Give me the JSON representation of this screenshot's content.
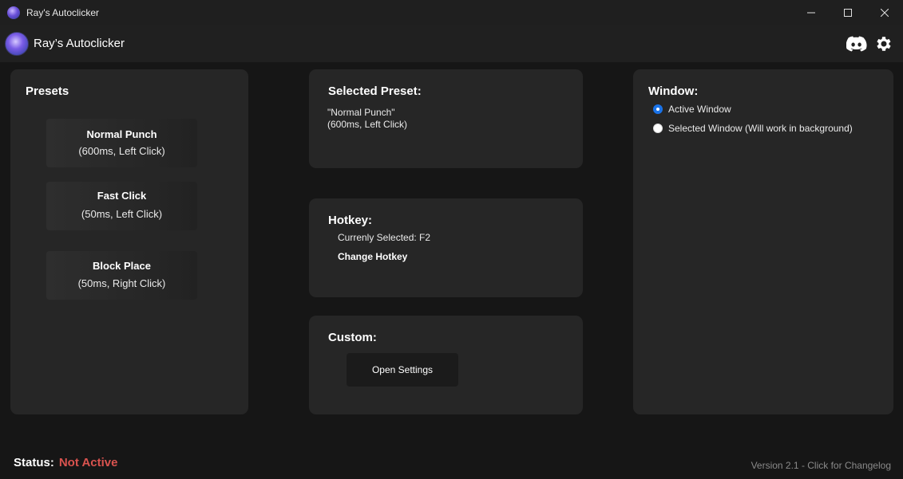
{
  "window": {
    "title": "Ray's Autoclicker",
    "controls": {
      "minimize": "minimize",
      "maximize": "maximize",
      "close": "close"
    }
  },
  "appbar": {
    "title": "Ray’s Autoclicker",
    "icons": [
      "discord-icon",
      "gear-icon"
    ]
  },
  "presets": {
    "title": "Presets",
    "items": [
      {
        "name": "Normal Punch",
        "desc": "(600ms, Left Click)"
      },
      {
        "name": "Fast Click",
        "desc": "(50ms, Left Click)"
      },
      {
        "name": "Block Place",
        "desc": "(50ms, Right Click)"
      }
    ]
  },
  "selected": {
    "title": "Selected Preset:",
    "line1": "\"Normal Punch\"",
    "line2": "(600ms, Left Click)"
  },
  "hotkey": {
    "title": "Hotkey:",
    "current": "Currenly Selected: F2",
    "change_label": "Change Hotkey"
  },
  "custom": {
    "title": "Custom:",
    "open_settings_label": "Open Settings"
  },
  "window_target": {
    "title": "Window:",
    "options": [
      {
        "label": "Active Window",
        "selected": true
      },
      {
        "label": "Selected Window (Will work in background)",
        "selected": false
      }
    ]
  },
  "status": {
    "label": "Status:",
    "value": "Not Active",
    "color": "#d9534f"
  },
  "version": "Version 2.1 - Click for Changelog",
  "colors": {
    "accent": "#1a73e8",
    "background": "#161616",
    "card": "#262626"
  }
}
